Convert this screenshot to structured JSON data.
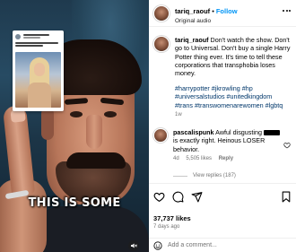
{
  "video": {
    "caption_overlay": "THIS IS SOME"
  },
  "post": {
    "header": {
      "username": "tariq_raouf",
      "separator": "•",
      "follow_label": "Follow",
      "subtitle": "Original audio"
    },
    "caption": {
      "username": "tariq_raouf",
      "text": "Don't watch the show. Don't go to Universal. Don't buy a single Harry Potter thing ever. It's time to tell these corporations that transphobia loses money.",
      "hashtags": "#harrypotter #jkrowling #hp #universalstudios #unitedkingdom #trans #transwomenarewomen #lgbtq",
      "time": "1w"
    },
    "comment": {
      "username": "pascalispunk",
      "text_before": "Awful disgusting",
      "text_after": "is exactly right. Heinous LOSER behavior.",
      "time": "4d",
      "likes": "5,505 likes",
      "reply_label": "Reply",
      "view_replies": "View replies (187)"
    },
    "likes_count": "37,737 likes",
    "date": "7 days ago",
    "add_comment_placeholder": "Add a comment..."
  }
}
